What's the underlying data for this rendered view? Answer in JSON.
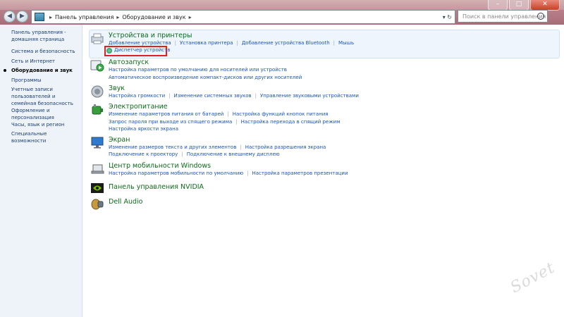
{
  "window": {
    "controls": [
      "–",
      "□",
      "✕"
    ],
    "breadcrumb": [
      "Панель управления",
      "Оборудование и звук"
    ],
    "search_placeholder": "Поиск в панели управления"
  },
  "sidebar": {
    "items": [
      {
        "label": "Панель управления - домашняя страница",
        "active": false
      },
      {
        "label": "Система и безопасность",
        "active": false
      },
      {
        "label": "Сеть и Интернет",
        "active": false
      },
      {
        "label": "Оборудование и звук",
        "active": true
      },
      {
        "label": "Программы",
        "active": false
      },
      {
        "label": "Учетные записи пользователей и семейная безопасность",
        "active": false
      },
      {
        "label": "Оформление и персонализация",
        "active": false
      },
      {
        "label": "Часы, язык и регион",
        "active": false
      },
      {
        "label": "Специальные возможности",
        "active": false
      }
    ]
  },
  "categories": {
    "devices": {
      "title": "Устройства и принтеры",
      "links": [
        "Добавление устройства",
        "Установка принтера",
        "Добавление устройства Bluetooth",
        "Мышь"
      ],
      "highlight_link": "Диспетчер устройств"
    },
    "autoplay": {
      "title": "Автозапуск",
      "links1": [
        "Настройка параметров по умолчанию для носителей или устройств"
      ],
      "links2": [
        "Автоматическое воспроизведение компакт-дисков или других носителей"
      ]
    },
    "sound": {
      "title": "Звук",
      "links": [
        "Настройка громкости",
        "Изменение системных звуков",
        "Управление звуковыми устройствами"
      ]
    },
    "power": {
      "title": "Электропитание",
      "links1": [
        "Изменение параметров питания от батарей",
        "Настройка функций кнопок питания"
      ],
      "links2": [
        "Запрос пароля при выходе из спящего режима",
        "Настройка перехода в спящий режим"
      ],
      "links3": [
        "Настройка яркости экрана"
      ]
    },
    "display": {
      "title": "Экран",
      "links1": [
        "Изменение размеров текста и других элементов",
        "Настройка разрешения экрана"
      ],
      "links2": [
        "Подключение к проектору",
        "Подключение к внешнему дисплею"
      ]
    },
    "mobility": {
      "title": "Центр мобильности Windows",
      "links": [
        "Настройка параметров мобильности по умолчанию",
        "Настройка параметров презентации"
      ]
    },
    "nvidia": {
      "title": "Панель управления NVIDIA"
    },
    "dell": {
      "title": "Dell Audio"
    }
  },
  "watermark": "Sovet"
}
